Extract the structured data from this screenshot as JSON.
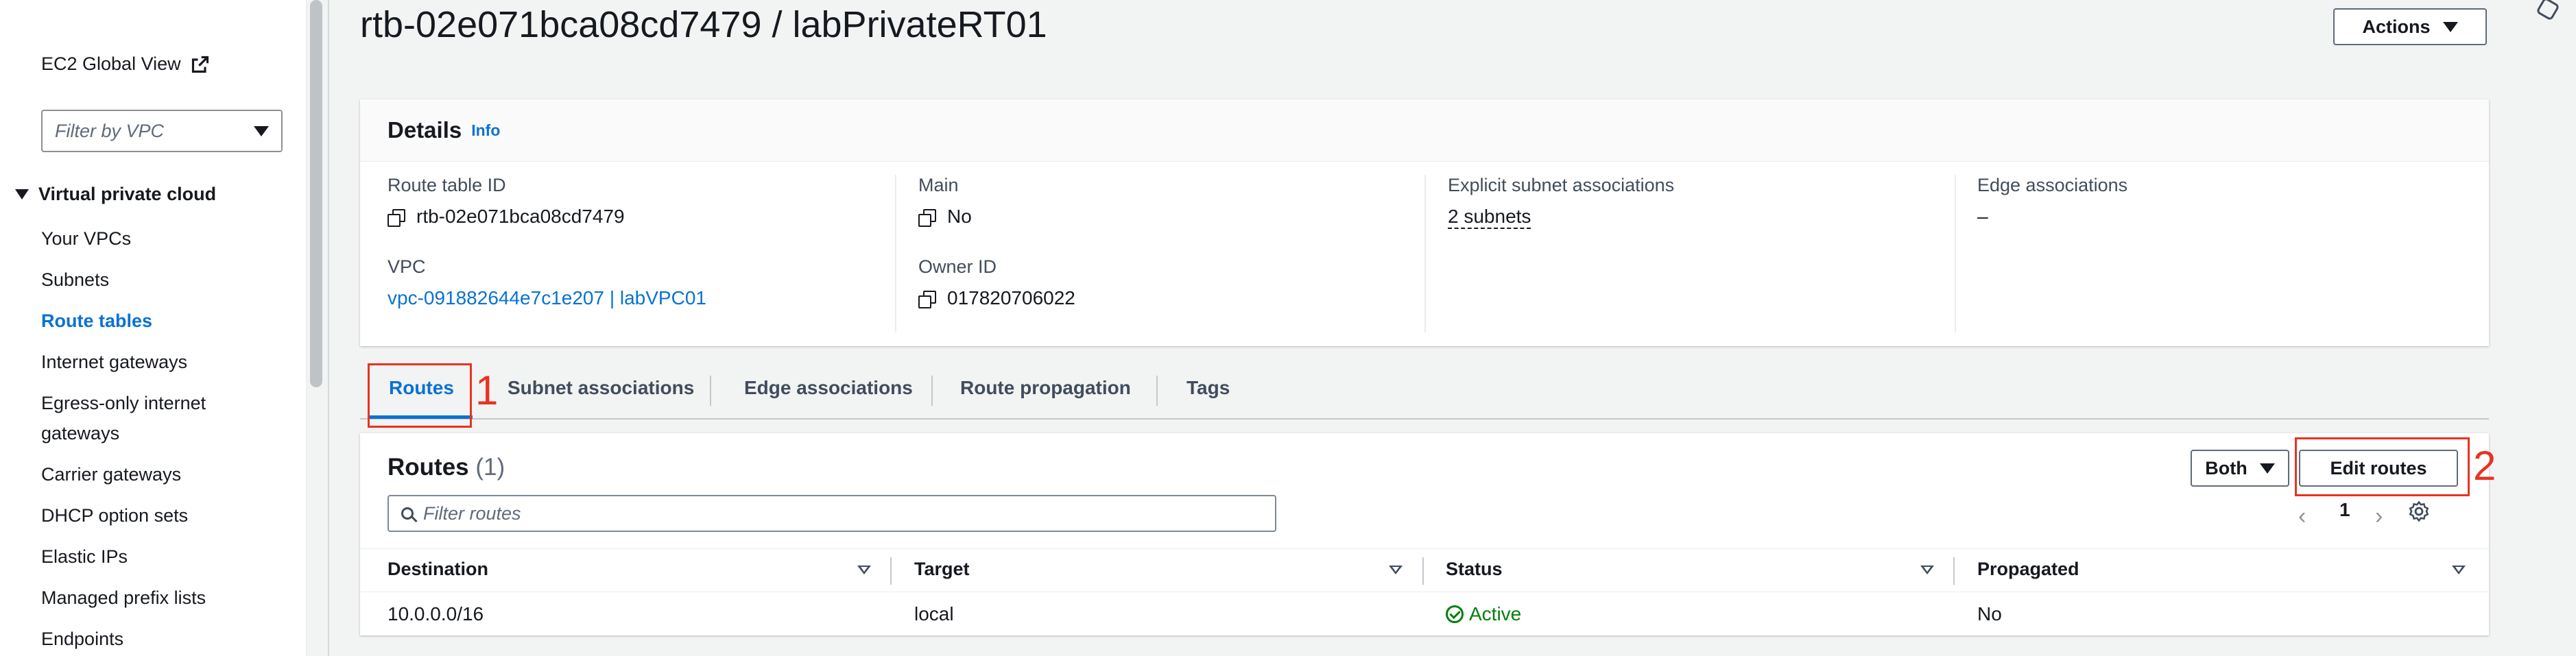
{
  "sidebar": {
    "global_view": "EC2 Global View",
    "filter_placeholder": "Filter by VPC",
    "section": "Virtual private cloud",
    "items": [
      {
        "label": "Your VPCs"
      },
      {
        "label": "Subnets"
      },
      {
        "label": "Route tables"
      },
      {
        "label": "Internet gateways"
      },
      {
        "label": "Egress-only internet"
      },
      {
        "label": "gateways"
      },
      {
        "label": "Carrier gateways"
      },
      {
        "label": "DHCP option sets"
      },
      {
        "label": "Elastic IPs"
      },
      {
        "label": "Managed prefix lists"
      },
      {
        "label": "Endpoints"
      }
    ],
    "active_item": "Route tables"
  },
  "page": {
    "title": "rtb-02e071bca08cd7479 / labPrivateRT01",
    "actions_label": "Actions"
  },
  "details": {
    "heading": "Details",
    "info": "Info",
    "route_table_id_label": "Route table ID",
    "route_table_id": "rtb-02e071bca08cd7479",
    "vpc_label": "VPC",
    "vpc_value": "vpc-091882644e7c1e207 | labVPC01",
    "main_label": "Main",
    "main_value": "No",
    "owner_label": "Owner ID",
    "owner_value": "017820706022",
    "explicit_label": "Explicit subnet associations",
    "explicit_value": "2 subnets",
    "edge_label": "Edge associations",
    "edge_value": "–"
  },
  "tabs": [
    {
      "label": "Routes"
    },
    {
      "label": "Subnet associations"
    },
    {
      "label": "Edge associations"
    },
    {
      "label": "Route propagation"
    },
    {
      "label": "Tags"
    }
  ],
  "annotations": {
    "one": "1",
    "two": "2"
  },
  "routes": {
    "title": "Routes",
    "count": "(1)",
    "filter_placeholder": "Filter routes",
    "both_label": "Both",
    "edit_label": "Edit routes",
    "page": "1",
    "columns": [
      "Destination",
      "Target",
      "Status",
      "Propagated"
    ],
    "rows": [
      {
        "destination": "10.0.0.0/16",
        "target": "local",
        "status": "Active",
        "propagated": "No"
      }
    ]
  },
  "colors": {
    "accent": "#0972d3",
    "success": "#037f0c",
    "annotation": "#e8331f"
  }
}
